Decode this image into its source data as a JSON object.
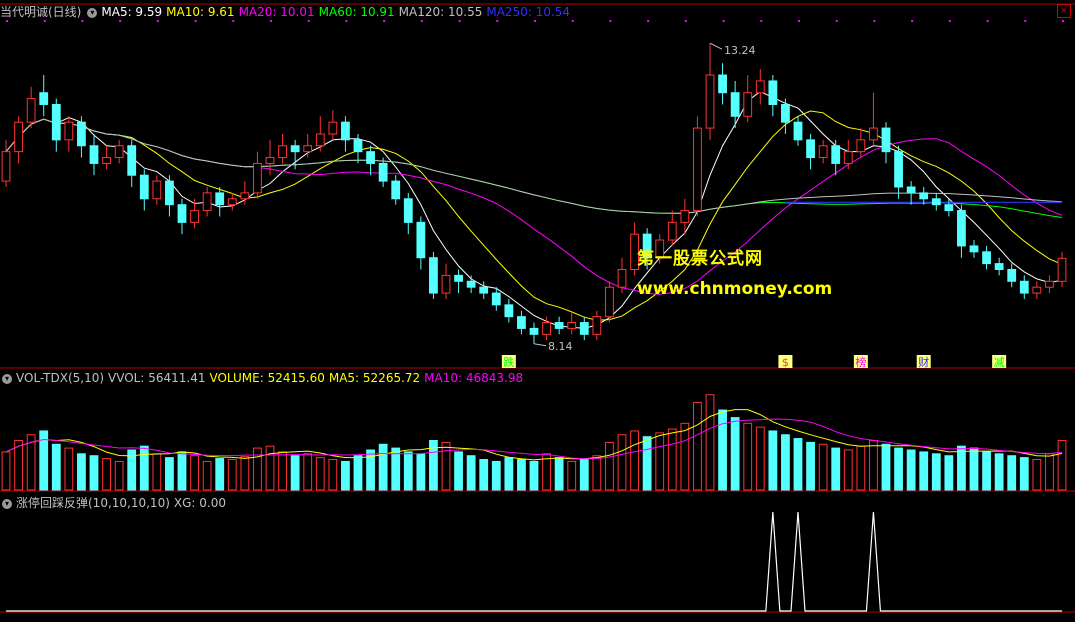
{
  "header": {
    "title": "当代明诚(日线)",
    "indicators": [
      {
        "label": "MA5: 9.59",
        "color": "#ffffff"
      },
      {
        "label": "MA10: 9.61",
        "color": "#ffff00"
      },
      {
        "label": "MA20: 10.01",
        "color": "#ff00ff"
      },
      {
        "label": "MA60: 10.91",
        "color": "#00ff00"
      },
      {
        "label": "MA120: 10.55",
        "color": "#c0c0c0"
      },
      {
        "label": "MA250: 10.54",
        "color": "#3030ff"
      }
    ]
  },
  "volume_header": {
    "name": "VOL-TDX(5,10)",
    "vvol": "VVOL: 56411.41",
    "volume": "VOLUME: 52415.60",
    "ma5": "MA5: 52265.72",
    "ma10": "MA10: 46843.98"
  },
  "signal_header": {
    "name": "涨停回踩反弹(10,10,10,10)",
    "xg": "XG: 0.00"
  },
  "watermark": {
    "line1": "第一股票公式网",
    "line2": "www.chnmoney.com"
  },
  "close_icon": "close-icon",
  "colors": {
    "up": "#ff3232",
    "down": "#54ffff",
    "ma5": "#ffffff",
    "ma10": "#ffff00",
    "ma20": "#ff00ff",
    "ma60": "#00ff00",
    "ma120": "#c0c0c0",
    "ma250": "#3030ff",
    "border": "#b00000"
  },
  "chart_data": [
    {
      "type": "candlestick",
      "panel": "price",
      "annotations": {
        "high": "13.24",
        "low": "8.14"
      },
      "markers": [
        {
          "text": "跌",
          "color": "#00ff00",
          "bg": "#ffff80"
        },
        {
          "text": "$",
          "color": "#ff3232",
          "bg": "#ffff80"
        },
        {
          "text": "榜",
          "color": "#ff00ff",
          "bg": "#ffff80"
        },
        {
          "text": "财",
          "color": "#3030ff",
          "bg": "#ffff80"
        },
        {
          "text": "减",
          "color": "#00ff00",
          "bg": "#ffff80"
        }
      ],
      "candles": [
        [
          10.9,
          11.4,
          11.6,
          10.8
        ],
        [
          11.4,
          11.9,
          12.0,
          11.2
        ],
        [
          11.9,
          12.3,
          12.5,
          11.8
        ],
        [
          12.4,
          12.2,
          12.7,
          12.0
        ],
        [
          12.2,
          11.6,
          12.3,
          11.4
        ],
        [
          11.6,
          11.9,
          12.0,
          11.4
        ],
        [
          11.9,
          11.5,
          12.0,
          11.3
        ],
        [
          11.5,
          11.2,
          11.7,
          11.0
        ],
        [
          11.2,
          11.3,
          11.5,
          11.1
        ],
        [
          11.3,
          11.5,
          11.6,
          11.2
        ],
        [
          11.5,
          11.0,
          11.6,
          10.8
        ],
        [
          11.0,
          10.6,
          11.1,
          10.4
        ],
        [
          10.6,
          10.9,
          11.0,
          10.5
        ],
        [
          10.9,
          10.5,
          11.0,
          10.3
        ],
        [
          10.5,
          10.2,
          10.6,
          10.0
        ],
        [
          10.2,
          10.4,
          10.6,
          10.1
        ],
        [
          10.4,
          10.7,
          10.8,
          10.3
        ],
        [
          10.7,
          10.5,
          10.8,
          10.3
        ],
        [
          10.5,
          10.6,
          10.7,
          10.4
        ],
        [
          10.6,
          10.7,
          10.9,
          10.5
        ],
        [
          10.7,
          11.2,
          11.4,
          10.6
        ],
        [
          11.2,
          11.3,
          11.6,
          11.0
        ],
        [
          11.3,
          11.5,
          11.7,
          11.2
        ],
        [
          11.5,
          11.4,
          11.6,
          11.1
        ],
        [
          11.4,
          11.5,
          11.7,
          11.3
        ],
        [
          11.5,
          11.7,
          12.0,
          11.4
        ],
        [
          11.7,
          11.9,
          12.1,
          11.6
        ],
        [
          11.9,
          11.6,
          12.0,
          11.4
        ],
        [
          11.6,
          11.4,
          11.7,
          11.2
        ],
        [
          11.4,
          11.2,
          11.5,
          11.0
        ],
        [
          11.2,
          10.9,
          11.3,
          10.8
        ],
        [
          10.9,
          10.6,
          11.0,
          10.5
        ],
        [
          10.6,
          10.2,
          10.7,
          10.0
        ],
        [
          10.2,
          9.6,
          10.3,
          9.4
        ],
        [
          9.6,
          9.0,
          9.7,
          8.9
        ],
        [
          9.0,
          9.3,
          9.5,
          8.9
        ],
        [
          9.3,
          9.2,
          9.4,
          9.0
        ],
        [
          9.2,
          9.1,
          9.3,
          9.0
        ],
        [
          9.1,
          9.0,
          9.2,
          8.9
        ],
        [
          9.0,
          8.8,
          9.1,
          8.7
        ],
        [
          8.8,
          8.6,
          8.9,
          8.5
        ],
        [
          8.6,
          8.4,
          8.7,
          8.3
        ],
        [
          8.4,
          8.3,
          8.5,
          8.14
        ],
        [
          8.3,
          8.5,
          8.6,
          8.2
        ],
        [
          8.5,
          8.4,
          8.6,
          8.3
        ],
        [
          8.4,
          8.5,
          8.7,
          8.3
        ],
        [
          8.5,
          8.3,
          8.6,
          8.2
        ],
        [
          8.3,
          8.6,
          8.7,
          8.2
        ],
        [
          8.6,
          9.1,
          9.2,
          8.5
        ],
        [
          9.1,
          9.4,
          9.6,
          9.0
        ],
        [
          9.4,
          10.0,
          10.2,
          9.3
        ],
        [
          10.0,
          9.6,
          10.1,
          9.4
        ],
        [
          9.6,
          9.9,
          10.0,
          9.5
        ],
        [
          9.9,
          10.2,
          10.4,
          9.8
        ],
        [
          10.2,
          10.4,
          10.6,
          10.0
        ],
        [
          10.4,
          11.8,
          12.0,
          10.3
        ],
        [
          11.8,
          12.7,
          13.24,
          11.6
        ],
        [
          12.7,
          12.4,
          12.9,
          12.2
        ],
        [
          12.4,
          12.0,
          12.6,
          11.8
        ],
        [
          12.0,
          12.4,
          12.7,
          11.9
        ],
        [
          12.4,
          12.6,
          12.8,
          12.2
        ],
        [
          12.6,
          12.2,
          12.7,
          12.0
        ],
        [
          12.2,
          11.9,
          12.3,
          11.7
        ],
        [
          11.9,
          11.6,
          12.0,
          11.5
        ],
        [
          11.6,
          11.3,
          11.7,
          11.1
        ],
        [
          11.3,
          11.5,
          11.6,
          11.2
        ],
        [
          11.5,
          11.2,
          11.6,
          11.0
        ],
        [
          11.2,
          11.4,
          11.6,
          11.1
        ],
        [
          11.4,
          11.6,
          11.8,
          11.3
        ],
        [
          11.6,
          11.8,
          12.4,
          11.5
        ],
        [
          11.8,
          11.4,
          11.9,
          11.2
        ],
        [
          11.4,
          10.8,
          11.5,
          10.6
        ],
        [
          10.8,
          10.7,
          10.9,
          10.5
        ],
        [
          10.7,
          10.6,
          10.8,
          10.5
        ],
        [
          10.6,
          10.5,
          10.7,
          10.4
        ],
        [
          10.5,
          10.4,
          10.6,
          10.3
        ],
        [
          10.4,
          9.8,
          10.5,
          9.6
        ],
        [
          9.8,
          9.7,
          9.9,
          9.6
        ],
        [
          9.7,
          9.5,
          9.8,
          9.4
        ],
        [
          9.5,
          9.4,
          9.6,
          9.3
        ],
        [
          9.4,
          9.2,
          9.5,
          9.1
        ],
        [
          9.2,
          9.0,
          9.3,
          8.9
        ],
        [
          9.0,
          9.1,
          9.2,
          8.9
        ],
        [
          9.1,
          9.2,
          9.3,
          9.0
        ],
        [
          9.2,
          9.59,
          9.7,
          9.1
        ]
      ]
    },
    {
      "type": "bar",
      "panel": "volume",
      "values": [
        40,
        52,
        58,
        62,
        48,
        44,
        38,
        36,
        33,
        30,
        42,
        46,
        38,
        34,
        40,
        36,
        30,
        33,
        32,
        35,
        44,
        46,
        40,
        36,
        38,
        34,
        32,
        30,
        36,
        42,
        48,
        44,
        40,
        38,
        52,
        50,
        40,
        36,
        32,
        30,
        34,
        32,
        30,
        38,
        34,
        30,
        32,
        36,
        50,
        58,
        62,
        56,
        60,
        64,
        70,
        92,
        100,
        84,
        76,
        70,
        66,
        62,
        58,
        54,
        50,
        48,
        44,
        42,
        46,
        52,
        48,
        44,
        42,
        40,
        38,
        36,
        46,
        44,
        40,
        38,
        36,
        34,
        32,
        38,
        52
      ]
    },
    {
      "type": "line",
      "panel": "signal",
      "xg_spikes_at": [
        61,
        63,
        69
      ],
      "values_note": ""
    }
  ]
}
